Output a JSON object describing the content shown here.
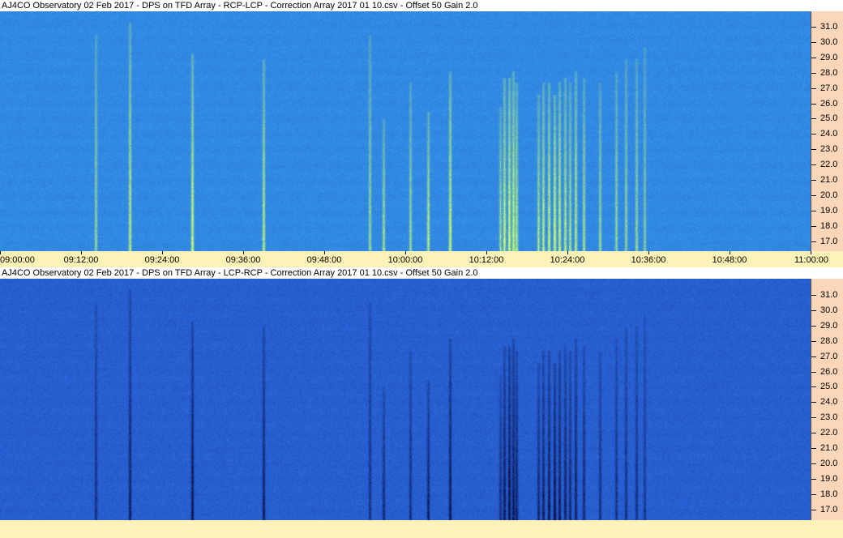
{
  "colors": {
    "page_background": "#fff5d4",
    "axis_background": "#fbd6b8",
    "time_axis_background": "#fff2b8",
    "title_background": "#ffffff"
  },
  "panels": [
    {
      "title": "AJ4CO Observatory 02 Feb 2017  -  DPS on TFD Array  -  RCP-LCP  -  Correction Array 2017 01 10.csv  -  Offset 50  Gain 2.0",
      "colormap": "blue-to-yellow (bright bursts)",
      "freq_ticks": [
        "31.0",
        "30.0",
        "29.0",
        "28.0",
        "27.0",
        "26.0",
        "25.0",
        "24.0",
        "23.0",
        "22.0",
        "21.0",
        "20.0",
        "19.0",
        "18.0",
        "17.0"
      ]
    },
    {
      "title": "AJ4CO Observatory 02 Feb 2017  -  DPS on TFD Array  -  LCP-RCP  -  Correction Array 2017 01 10.csv  -  Offset 50  Gain 2.0",
      "colormap": "blue-to-dark (dark bursts)",
      "freq_ticks": [
        "31.0",
        "30.0",
        "29.0",
        "28.0",
        "27.0",
        "26.0",
        "25.0",
        "24.0",
        "23.0",
        "22.0",
        "21.0",
        "20.0",
        "19.0",
        "18.0",
        "17.0"
      ]
    }
  ],
  "time_axis": {
    "ticks": [
      "09:00:00",
      "09:12:00",
      "09:24:00",
      "09:36:00",
      "09:48:00",
      "10:00:00",
      "10:12:00",
      "10:24:00",
      "10:36:00",
      "10:48:00",
      "11:00:00"
    ]
  }
}
